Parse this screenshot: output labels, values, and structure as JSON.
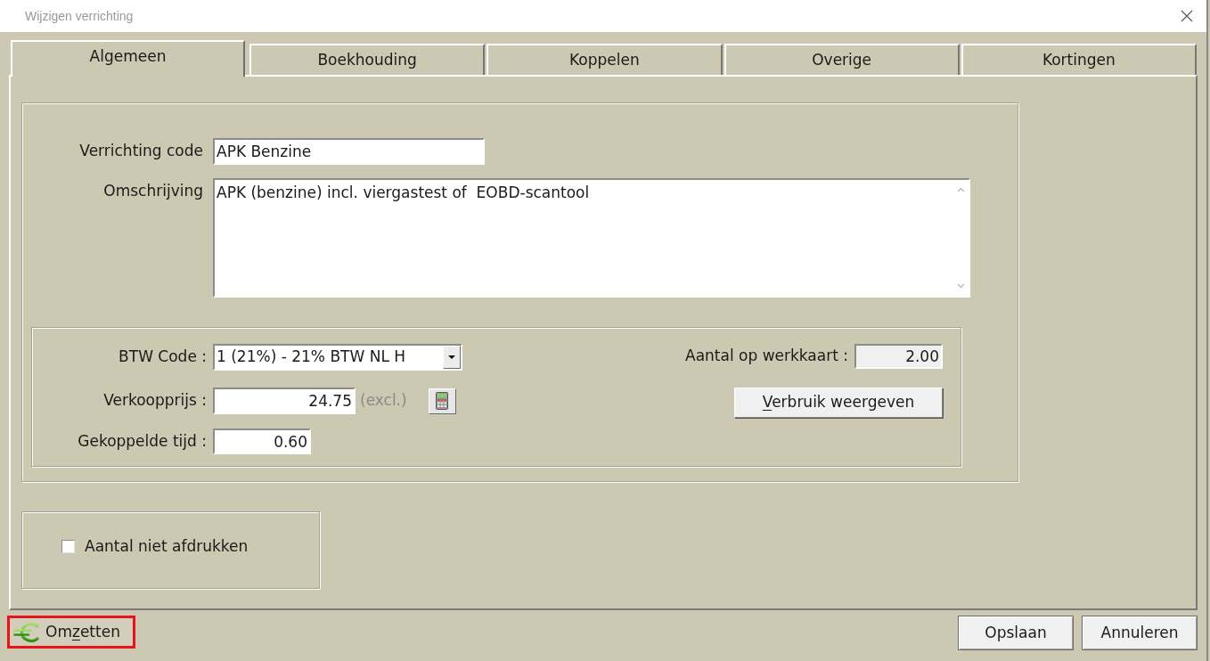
{
  "window": {
    "title": "Wijzigen verrichting"
  },
  "tabs": [
    {
      "label": "Algemeen",
      "selected": true
    },
    {
      "label": "Boekhouding",
      "selected": false
    },
    {
      "label": "Koppelen",
      "selected": false
    },
    {
      "label": "Overige",
      "selected": false
    },
    {
      "label": "Kortingen",
      "selected": false
    }
  ],
  "general": {
    "code": {
      "label": "Verrichting code",
      "value": "APK Benzine"
    },
    "description": {
      "label": "Omschrijving",
      "value": "APK (benzine) incl. viergastest of  EOBD-scantool"
    }
  },
  "pricing": {
    "vat_code": {
      "label": "BTW Code :",
      "value": "1 (21%) - 21% BTW NL H"
    },
    "sale_price": {
      "label": "Verkoopprijs :",
      "value": "24.75",
      "suffix": "(excl.)"
    },
    "linked_time": {
      "label": "Gekoppelde tijd :",
      "value": "0.60"
    },
    "quantity_on_workcard": {
      "label": "Aantal op werkkaart :",
      "value": "2.00",
      "readonly": true
    },
    "usage_button": {
      "label_runs": [
        {
          "text": "V",
          "underlined": true
        },
        {
          "text": "erbruik weergeven",
          "underlined": false
        }
      ]
    }
  },
  "print_option": {
    "label": "Aantal niet afdrukken",
    "checked": false
  },
  "footer": {
    "convert_button": {
      "label_runs": [
        {
          "text": "Om",
          "underlined": false
        },
        {
          "text": "z",
          "underlined": true
        },
        {
          "text": "etten",
          "underlined": false
        }
      ],
      "highlighted": true
    },
    "buttons": [
      {
        "label": "Opslaan"
      },
      {
        "label": "Annuleren"
      }
    ]
  }
}
